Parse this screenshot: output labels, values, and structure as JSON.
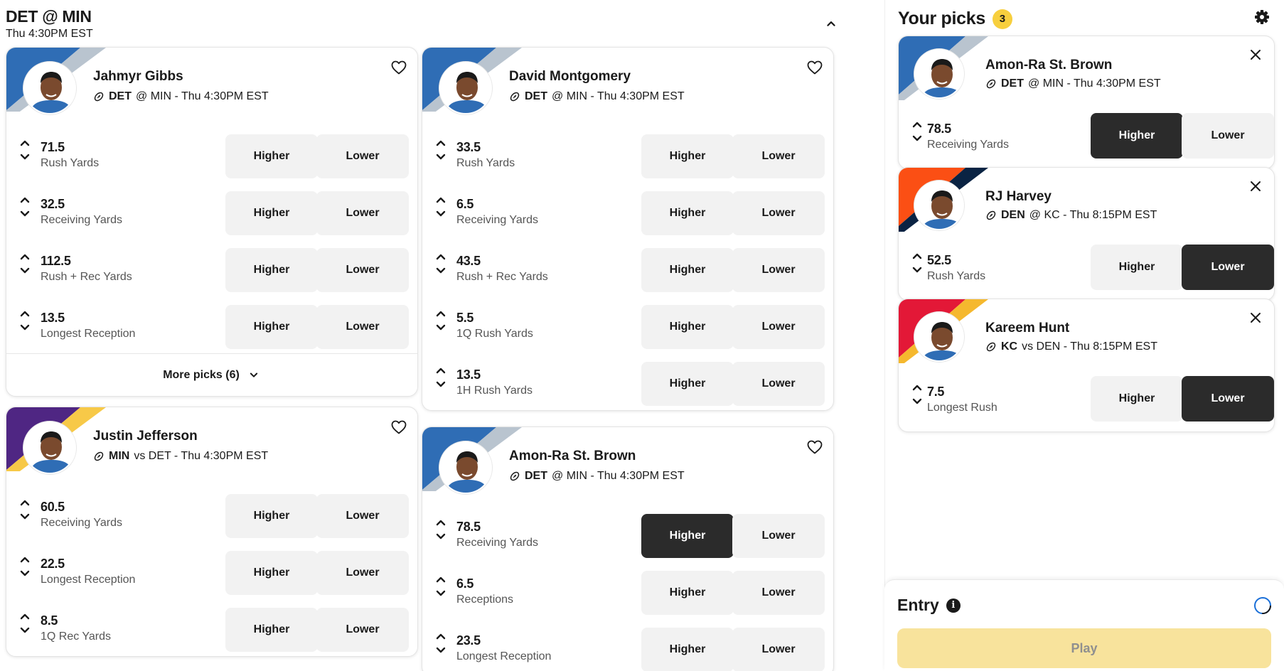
{
  "game": {
    "title": "DET @ MIN",
    "time": "Thu 4:30PM EST"
  },
  "cards": [
    {
      "name": "Jahmyr Gibbs",
      "team": "DET",
      "matchup_rest": "@ MIN - Thu 4:30PM EST",
      "team_colors": [
        "#2f6db5",
        "#b9c4cf"
      ],
      "props": [
        {
          "value": "71.5",
          "label": "Rush Yards"
        },
        {
          "value": "32.5",
          "label": "Receiving Yards"
        },
        {
          "value": "112.5",
          "label": "Rush + Rec Yards"
        },
        {
          "value": "13.5",
          "label": "Longest Reception"
        }
      ],
      "more_label": "More picks (6)"
    },
    {
      "name": "David Montgomery",
      "team": "DET",
      "matchup_rest": "@ MIN - Thu 4:30PM EST",
      "team_colors": [
        "#2f6db5",
        "#b9c4cf"
      ],
      "props": [
        {
          "value": "33.5",
          "label": "Rush Yards"
        },
        {
          "value": "6.5",
          "label": "Receiving Yards"
        },
        {
          "value": "43.5",
          "label": "Rush + Rec Yards"
        },
        {
          "value": "5.5",
          "label": "1Q Rush Yards"
        },
        {
          "value": "13.5",
          "label": "1H Rush Yards"
        }
      ]
    },
    {
      "name": "Justin Jefferson",
      "team": "MIN",
      "matchup_rest": "vs DET - Thu 4:30PM EST",
      "team_colors": [
        "#4f2683",
        "#f7c948"
      ],
      "props": [
        {
          "value": "60.5",
          "label": "Receiving Yards"
        },
        {
          "value": "22.5",
          "label": "Longest Reception"
        },
        {
          "value": "8.5",
          "label": "1Q Rec Yards"
        }
      ]
    },
    {
      "name": "Amon-Ra St. Brown",
      "team": "DET",
      "matchup_rest": "@ MIN - Thu 4:30PM EST",
      "team_colors": [
        "#2f6db5",
        "#b9c4cf"
      ],
      "props": [
        {
          "value": "78.5",
          "label": "Receiving Yards",
          "selected": "higher"
        },
        {
          "value": "6.5",
          "label": "Receptions"
        },
        {
          "value": "23.5",
          "label": "Longest Reception"
        }
      ]
    }
  ],
  "buttons": {
    "higher": "Higher",
    "lower": "Lower"
  },
  "picks": {
    "title": "Your picks",
    "count": "3",
    "items": [
      {
        "name": "Amon-Ra St. Brown",
        "team": "DET",
        "matchup_rest": "@ MIN - Thu 4:30PM EST",
        "team_colors": [
          "#2f6db5",
          "#b9c4cf"
        ],
        "value": "78.5",
        "label": "Receiving Yards",
        "selected": "higher"
      },
      {
        "name": "RJ Harvey",
        "team": "DEN",
        "matchup_rest": "@ KC - Thu 8:15PM EST",
        "team_colors": [
          "#fb4f14",
          "#0a2343"
        ],
        "value": "52.5",
        "label": "Rush Yards",
        "selected": "lower"
      },
      {
        "name": "Kareem Hunt",
        "team": "KC",
        "matchup_rest": "vs DEN - Thu 8:15PM EST",
        "team_colors": [
          "#e31837",
          "#f5b82e"
        ],
        "value": "7.5",
        "label": "Longest Rush",
        "selected": "lower"
      }
    ]
  },
  "entry": {
    "title": "Entry",
    "play_label": "Play"
  },
  "colors": {
    "accent_yellow": "#f7cf3e",
    "selected_dark": "#2b2b2b",
    "button_gray": "#f2f2f2",
    "play_disabled": "#f8e39c"
  },
  "icons": [
    "heart-icon",
    "chevron-up-icon",
    "chevron-down-icon",
    "football-icon",
    "close-icon",
    "gear-icon",
    "info-icon",
    "toggle-icon"
  ]
}
